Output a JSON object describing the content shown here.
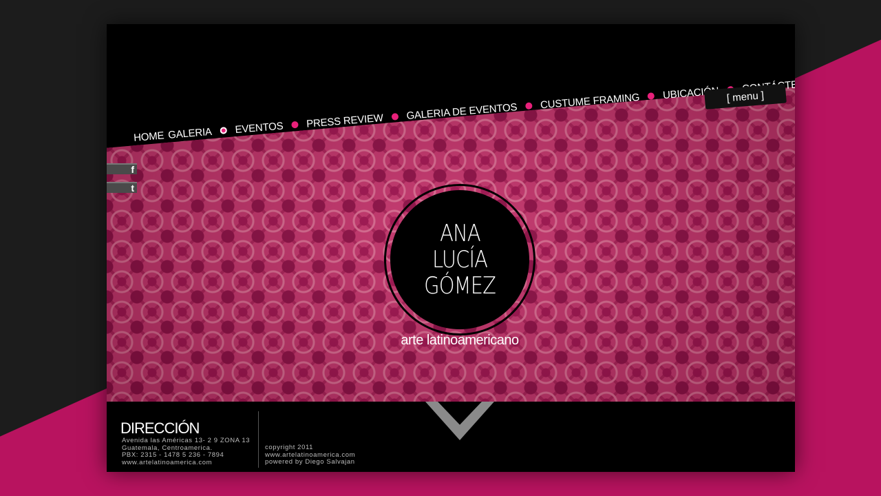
{
  "nav": {
    "items": [
      {
        "label": "HOME"
      },
      {
        "label": "GALERIA"
      },
      {
        "label": "EVENTOS"
      },
      {
        "label": "PRESS REVIEW"
      },
      {
        "label": "GALERIA DE  EVENTOS"
      },
      {
        "label": "CUSTUME FRAMING"
      },
      {
        "label": "UBICACIÓN"
      },
      {
        "label": "CONTÁCTENOS"
      }
    ],
    "menu_label": "[ menu ]"
  },
  "social": {
    "facebook": "f",
    "twitter": "t"
  },
  "logo": {
    "line1": "ANA",
    "line2": "LUCÍA",
    "line3": "GÓMEZ"
  },
  "tagline": "arte latinoamericano",
  "footer": {
    "direccion_title": "DIRECCIÓN",
    "address": [
      "Avenida las Américas 13- 2 9 ZONA 13",
      "Guatemala, Centroamerica.",
      "PBX:  2315 - 1478  5 236 - 7894",
      "www.artelatinoamerica.com"
    ],
    "copyright": [
      "copyright 2011",
      "www.artelatinoamerica.com",
      "powered by Diego Salvajan"
    ]
  },
  "colors": {
    "accent": "#e8207a",
    "pattern": "#c4336b",
    "background": "#1c1c1c"
  }
}
